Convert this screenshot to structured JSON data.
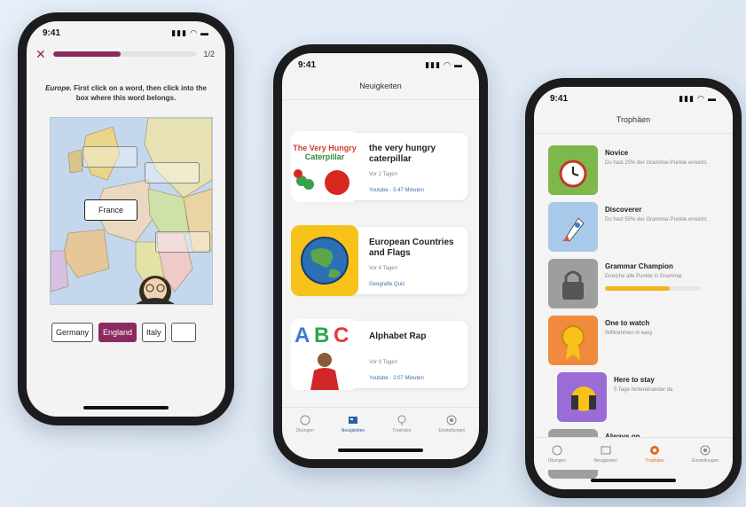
{
  "status": {
    "time": "9:41"
  },
  "quiz": {
    "progress_fraction": 0.47,
    "counter": "1/2",
    "instruction_em": "Europe.",
    "instruction_rest": " First click on a word, then click into the box where this word belongs.",
    "placed_word": "France",
    "words": [
      "Germany",
      "England",
      "Italy",
      ""
    ],
    "active_word_index": 1
  },
  "news": {
    "header": "Neuigkeiten",
    "cards": [
      {
        "title": "the very hungry caterpillar",
        "meta": "Vor 2 Tagen",
        "tag": "Youtube · 5:47 Minuten",
        "thumb_text": "The Very Hungry Caterpillar"
      },
      {
        "title": "European Countries and Flags",
        "meta": "Vor 4 Tagen",
        "tag": "Geografie Quiz"
      },
      {
        "title": "Alphabet Rap",
        "meta": "Vor 9 Tagen",
        "tag": "Youtube · 2:07 Minuten",
        "thumb_text": "ABC"
      }
    ],
    "tabs": [
      "Übungen",
      "Neuigkeiten",
      "Trophäen",
      "Einstellungen"
    ],
    "active_tab": 1
  },
  "trophies": {
    "header": "Trophäen",
    "items": [
      {
        "title": "Novice",
        "desc": "Du hast 25% der Grammar-Punkte erreicht.",
        "color": "#7fb84a"
      },
      {
        "title": "Discoverer",
        "desc": "Du hast 50% der Grammar-Punkte erreicht.",
        "color": "#a9c9ea"
      },
      {
        "title": "Grammar Champion",
        "desc": "Erreiche alle Punkte in Grammar",
        "color": "#9e9e9e",
        "progress": 0.68
      },
      {
        "title": "One to watch",
        "desc": "Willkommen in easy",
        "color": "#f08a3c"
      },
      {
        "title": "Here to stay",
        "desc": "5 Tage hintereinander da",
        "color": "#9b6bd6"
      },
      {
        "title": "Always on",
        "desc": "",
        "color": "#9e9e9e"
      }
    ],
    "tabs": [
      "Übungen",
      "Neuigkeiten",
      "Trophäen",
      "Einstellungen"
    ],
    "active_tab": 2
  }
}
